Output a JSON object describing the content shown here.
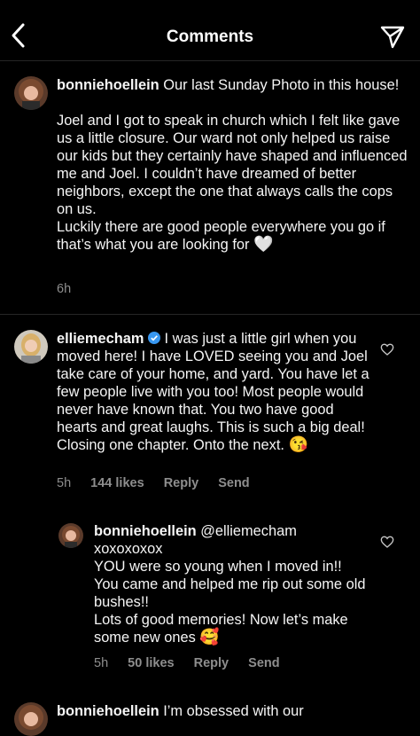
{
  "header": {
    "title": "Comments"
  },
  "caption": {
    "username": "bonniehoellein",
    "first_line": "Our last Sunday Photo in this house!",
    "p1": "Joel and I got to speak in church which I felt like gave us a little closure. Our ward not only helped us raise our kids but they certainly have shaped and influenced me and Joel. I couldn’t have dreamed of better neighbors, except the one that always calls the cops on us.",
    "p2": "Luckily there are good people everywhere you go if that’s what you are looking for",
    "emoji": "🤍",
    "time": "6h"
  },
  "comment1": {
    "username": "elliemecham",
    "verified_icon": "verified-badge-icon",
    "text": "I was just a little girl when you moved here! I have LOVED seeing you and Joel take care of your home, and yard. You have let a few people live with you too! Most people would never have known that. You two have good hearts and great laughs. This is such a big deal! Closing one chapter. Onto the next.",
    "emoji": "😘",
    "time": "5h",
    "likes": "144 likes",
    "reply": "Reply",
    "send": "Send"
  },
  "reply1": {
    "username": "bonniehoellein",
    "mention": "@elliemecham",
    "line2": "xoxoxoxox",
    "line3": "YOU were so young when I moved in!!",
    "line4": "You came and helped me rip out some old bushes!!",
    "line5": "Lots of good memories! Now let’s make some new ones",
    "emoji": "🥰",
    "time": "5h",
    "likes": "50 likes",
    "reply": "Reply",
    "send": "Send"
  },
  "comment3": {
    "username": "bonniehoellein",
    "text": "I’m obsessed with our"
  },
  "colors": {
    "background": "#000000",
    "text": "#f5f5f5",
    "muted": "#8e8e8e",
    "verified": "#3897f0"
  }
}
